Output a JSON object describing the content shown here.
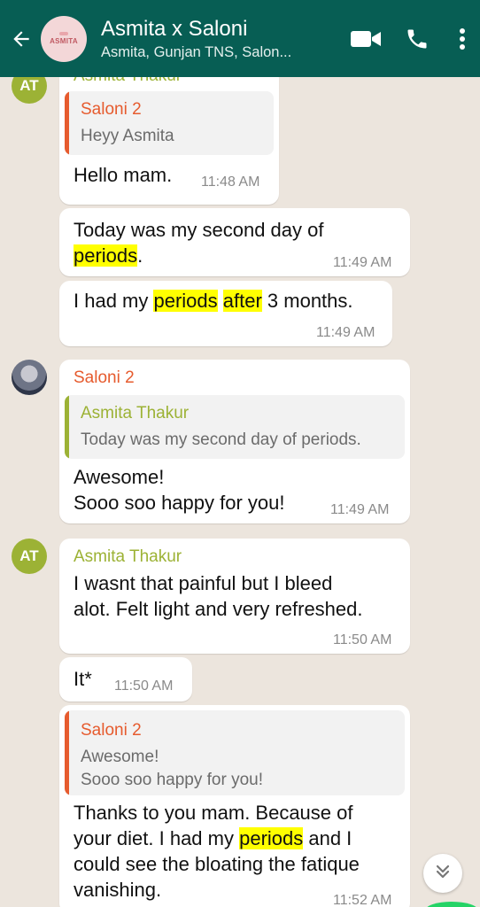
{
  "header": {
    "group_name": "Asmita x Saloni",
    "members": "Asmita, Gunjan TNS, Salon...",
    "avatar_text": "ASMITA"
  },
  "messages": [
    {
      "sender": "Asmita Thakur",
      "sender_color": "#9cb235",
      "avatar": "AT",
      "quote": {
        "name": "Saloni 2",
        "text": "Heyy Asmita"
      },
      "text": "Hello mam.",
      "time": "11:48 AM"
    },
    {
      "text_parts": [
        "Today was my second day of ",
        "periods",
        "."
      ],
      "time": "11:49 AM"
    },
    {
      "text_parts": [
        "I had my ",
        "periods",
        " ",
        "after",
        " 3 months."
      ],
      "time": "11:49 AM"
    },
    {
      "sender": "Saloni 2",
      "sender_color": "#e65b2e",
      "quote": {
        "name": "Asmita Thakur",
        "text": "Today was my second day of periods."
      },
      "lines": [
        "Awesome!",
        "Sooo soo happy for you!"
      ],
      "time": "11:49 AM"
    },
    {
      "sender": "Asmita Thakur",
      "avatar": "AT",
      "lines": [
        "I wasnt that painful but I bleed",
        "alot. Felt light and very refreshed."
      ],
      "time": "11:50 AM"
    },
    {
      "text": "It*",
      "time": "11:50 AM"
    },
    {
      "quote": {
        "name": "Saloni 2",
        "lines": [
          "Awesome!",
          "Sooo soo happy for you!"
        ]
      },
      "line1": "Thanks to you mam. Because of",
      "line2_parts": [
        "your diet. I had my ",
        "periods",
        " and I"
      ],
      "line3": "could see the bloating the fatique",
      "line4": "vanishing.",
      "time": "11:52 AM"
    }
  ],
  "colors": {
    "header": "#075e54",
    "highlight": "#ffff00",
    "asmita": "#9cb235",
    "saloni": "#e65b2e"
  },
  "icons": [
    "back-arrow-icon",
    "video-call-icon",
    "phone-icon",
    "more-vert-icon",
    "chevron-double-down-icon"
  ]
}
